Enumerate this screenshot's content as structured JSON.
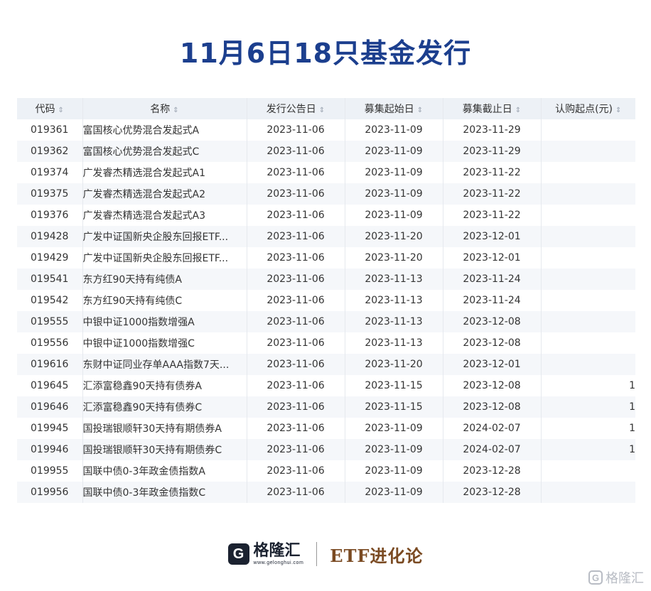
{
  "title": "11月6日18只基金发行",
  "table": {
    "columns": [
      "代码",
      "名称",
      "发行公告日",
      "募集起始日",
      "募集截止日",
      "认购起点(元)"
    ],
    "rows": [
      {
        "code": "019361",
        "name": "富国核心优势混合发起式A",
        "announce": "2023-11-06",
        "start": "2023-11-09",
        "end": "2023-11-29",
        "min": ""
      },
      {
        "code": "019362",
        "name": "富国核心优势混合发起式C",
        "announce": "2023-11-06",
        "start": "2023-11-09",
        "end": "2023-11-29",
        "min": ""
      },
      {
        "code": "019374",
        "name": "广发睿杰精选混合发起式A1",
        "announce": "2023-11-06",
        "start": "2023-11-09",
        "end": "2023-11-22",
        "min": ""
      },
      {
        "code": "019375",
        "name": "广发睿杰精选混合发起式A2",
        "announce": "2023-11-06",
        "start": "2023-11-09",
        "end": "2023-11-22",
        "min": ""
      },
      {
        "code": "019376",
        "name": "广发睿杰精选混合发起式A3",
        "announce": "2023-11-06",
        "start": "2023-11-09",
        "end": "2023-11-22",
        "min": ""
      },
      {
        "code": "019428",
        "name": "广发中证国新央企股东回报ETF...",
        "announce": "2023-11-06",
        "start": "2023-11-20",
        "end": "2023-12-01",
        "min": ""
      },
      {
        "code": "019429",
        "name": "广发中证国新央企股东回报ETF...",
        "announce": "2023-11-06",
        "start": "2023-11-20",
        "end": "2023-12-01",
        "min": ""
      },
      {
        "code": "019541",
        "name": "东方红90天持有纯债A",
        "announce": "2023-11-06",
        "start": "2023-11-13",
        "end": "2023-11-24",
        "min": ""
      },
      {
        "code": "019542",
        "name": "东方红90天持有纯债C",
        "announce": "2023-11-06",
        "start": "2023-11-13",
        "end": "2023-11-24",
        "min": ""
      },
      {
        "code": "019555",
        "name": "中银中证1000指数增强A",
        "announce": "2023-11-06",
        "start": "2023-11-13",
        "end": "2023-12-08",
        "min": ""
      },
      {
        "code": "019556",
        "name": "中银中证1000指数增强C",
        "announce": "2023-11-06",
        "start": "2023-11-13",
        "end": "2023-12-08",
        "min": ""
      },
      {
        "code": "019616",
        "name": "东财中证同业存单AAA指数7天...",
        "announce": "2023-11-06",
        "start": "2023-11-20",
        "end": "2023-12-01",
        "min": ""
      },
      {
        "code": "019645",
        "name": "汇添富稳鑫90天持有债券A",
        "announce": "2023-11-06",
        "start": "2023-11-15",
        "end": "2023-12-08",
        "min": "1"
      },
      {
        "code": "019646",
        "name": "汇添富稳鑫90天持有债券C",
        "announce": "2023-11-06",
        "start": "2023-11-15",
        "end": "2023-12-08",
        "min": "1"
      },
      {
        "code": "019945",
        "name": "国投瑞银顺轩30天持有期债券A",
        "announce": "2023-11-06",
        "start": "2023-11-09",
        "end": "2024-02-07",
        "min": "1"
      },
      {
        "code": "019946",
        "name": "国投瑞银顺轩30天持有期债券C",
        "announce": "2023-11-06",
        "start": "2023-11-09",
        "end": "2024-02-07",
        "min": "1"
      },
      {
        "code": "019955",
        "name": "国联中债0-3年政金债指数A",
        "announce": "2023-11-06",
        "start": "2023-11-09",
        "end": "2023-12-28",
        "min": ""
      },
      {
        "code": "019956",
        "name": "国联中债0-3年政金债指数C",
        "announce": "2023-11-06",
        "start": "2023-11-09",
        "end": "2023-12-28",
        "min": ""
      }
    ]
  },
  "footer": {
    "logo_mark": "G",
    "logo_name": "格隆汇",
    "logo_url": "www.gelonghui.com",
    "brand": "ETF进化论"
  },
  "watermark": {
    "icon": "G",
    "text": "格隆汇"
  }
}
